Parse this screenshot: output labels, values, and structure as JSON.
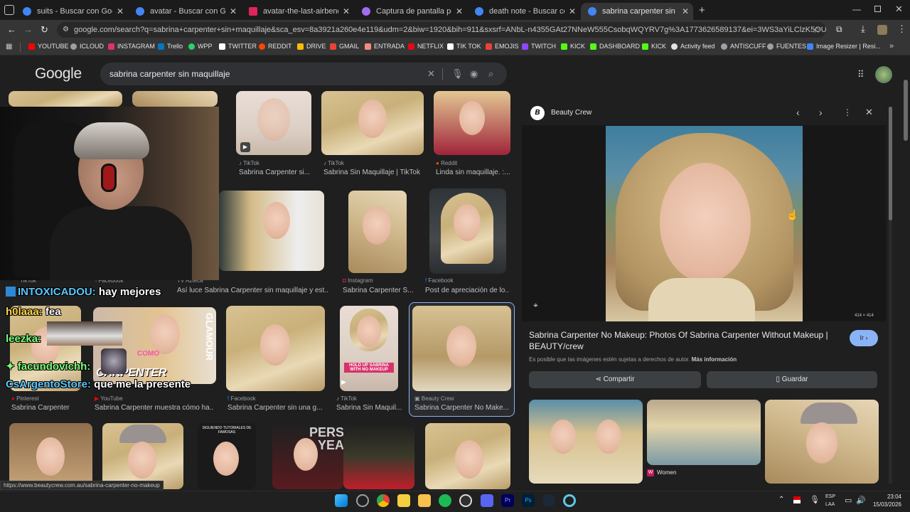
{
  "tabs": [
    {
      "title": "suits - Buscar con Google",
      "color": "#4285f4"
    },
    {
      "title": "avatar - Buscar con Google",
      "color": "#4285f4"
    },
    {
      "title": "avatar-the-last-airbender-is-ge",
      "color": "#e0245e"
    },
    {
      "title": "Captura de pantalla por Lightsh",
      "color": "#a16cf0"
    },
    {
      "title": "death note - Buscar con Google",
      "color": "#4285f4"
    },
    {
      "title": "sabrina carpenter sin maquillaje",
      "color": "#4285f4"
    }
  ],
  "address": {
    "url": "google.com/search?q=sabrina+carpenter+sin+maquillaje&sca_esv=8a3921a260e4e119&udm=2&biw=1920&bih=911&sxsrf=ANbL-n4355GAt27NNeW555CsobqWQYRV7g%3A1773626589137&ei=3WS3aYiLClzK5OUP8vysuAE&ved=0ahUKEwji7bz2..."
  },
  "bookmarks": [
    {
      "label": "YOUTUBE",
      "color": "#ff0000"
    },
    {
      "label": "ICLOUD",
      "color": "#9aa0a6"
    },
    {
      "label": "INSTAGRAM",
      "color": "#e1306c"
    },
    {
      "label": "Trello",
      "color": "#0079bf"
    },
    {
      "label": "WPP",
      "color": "#25d366"
    },
    {
      "label": "TWITTER",
      "color": "#ffffff"
    },
    {
      "label": "REDDIT",
      "color": "#ff4500"
    },
    {
      "label": "DRIVE",
      "color": "#fbbc04"
    },
    {
      "label": "GMAIL",
      "color": "#ea4335"
    },
    {
      "label": "ENTRADA",
      "color": "#f28b82"
    },
    {
      "label": "NETFLIX",
      "color": "#e50914"
    },
    {
      "label": "TIK TOK",
      "color": "#ffffff"
    },
    {
      "label": "EMOJIS",
      "color": "#ea4335"
    },
    {
      "label": "TWITCH",
      "color": "#9146ff"
    },
    {
      "label": "KICK",
      "color": "#53fc18"
    },
    {
      "label": "DASHBOARD",
      "color": "#53fc18"
    },
    {
      "label": "KICK",
      "color": "#53fc18"
    },
    {
      "label": "Activity feed",
      "color": "#e3e3e3"
    },
    {
      "label": "ANTISCUFF",
      "color": "#9aa0a6"
    },
    {
      "label": "FUENTES",
      "color": "#9aa0a6"
    },
    {
      "label": "Image Resizer | Resi...",
      "color": "#4285f4"
    }
  ],
  "google": {
    "logo": "Google",
    "query": "sabrina carpenter sin maquillaje"
  },
  "results": [
    {
      "source": "TikTok",
      "title": "Sabrina Carpenter si..."
    },
    {
      "source": "TikTok",
      "title": "Sabrina Sin Maquillaje | TikTok"
    },
    {
      "source": "Reddit",
      "title": "Linda sin maquillaje. :..."
    },
    {
      "source": "TikTok",
      "title": ""
    },
    {
      "source": "Facebook",
      "title": ""
    },
    {
      "source": "TV Azteca",
      "title": "Así luce Sabrina Carpenter sin maquillaje y est..."
    },
    {
      "source": "Instagram",
      "title": "Sabrina Carpenter S..."
    },
    {
      "source": "Facebook",
      "title": "Post de apreciación de lo..."
    },
    {
      "source": "Pinterest",
      "title": "Sabrina Carpenter"
    },
    {
      "source": "YouTube",
      "title": "Sabrina Carpenter muestra cómo ha..."
    },
    {
      "source": "Facebook",
      "title": "Sabrina Carpenter sin una g..."
    },
    {
      "source": "TikTok",
      "title": "Sabrina Sin Maquil..."
    },
    {
      "source": "Beauty Crew",
      "title": "Sabrina Carpenter No Make..."
    }
  ],
  "thumb_texts": {
    "glamour": "GLAMOUR",
    "como": "COMO",
    "carpenter": "CARPENTER",
    "holdup": "HOLD UP SABRINA WITH NO MAKEUP",
    "siguiendo": "SIGUIENDO TUTORIALES DE FAMOSAS",
    "person": "PERSO",
    "year": "YEA"
  },
  "panel": {
    "site": "Beauty Crew",
    "dimensions": "414 × 414",
    "title": "Sabrina Carpenter No Makeup: Photos Of Sabrina Carpenter Without Makeup | BEAUTY/crew",
    "go_label": "Ir",
    "copyright": "Es posible que las imágenes estén sujetas a derechos de autor.",
    "more_info": "Más información",
    "share_label": "Compartir",
    "save_label": "Guardar",
    "related_label": "Women"
  },
  "chat": [
    {
      "user": "INTOXICADOU:",
      "msg": " hay mejores",
      "color": "#5cc8ff"
    },
    {
      "user": "h0laaa:",
      "msg": " fea",
      "color": "#ffd84d"
    },
    {
      "user": "leezka:",
      "msg": "",
      "color": "#7cff7c"
    },
    {
      "user": "facundovichh:",
      "msg": "",
      "color": "#7cff7c"
    },
    {
      "user": "CsArgentoStore:",
      "msg": " que me la presente",
      "color": "#5cc8ff"
    }
  ],
  "status_url": "https://www.beautycrew.com.au/sabrina-carpenter-no-makeup",
  "tray": {
    "lang": "ESP",
    "layout": "LAA",
    "time": "23:04",
    "date": "15/03/2026"
  }
}
